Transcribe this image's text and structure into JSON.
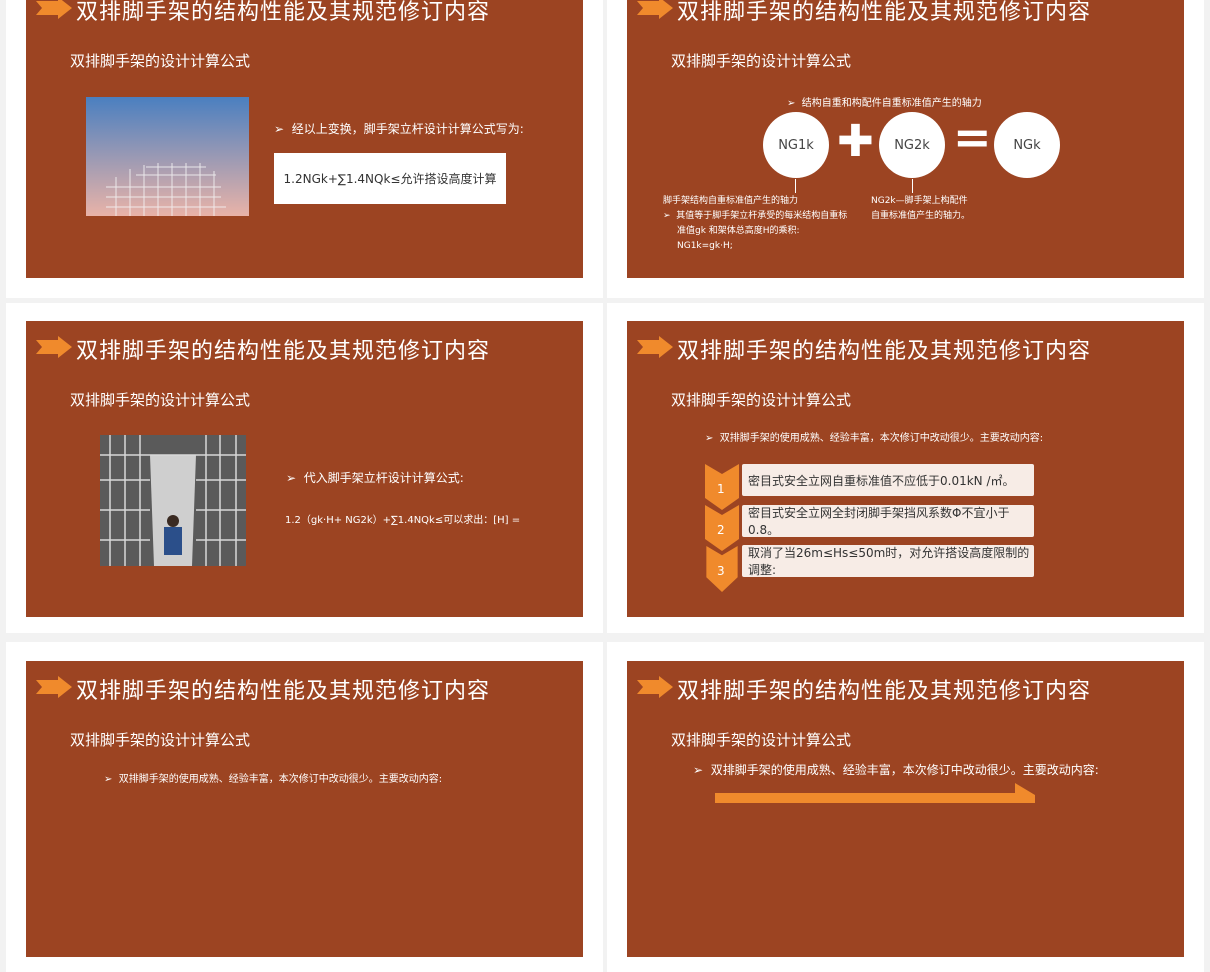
{
  "slide_title": "双排脚手架的结构性能及其规范修订内容",
  "slide_subtitle": "双排脚手架的设计计算公式",
  "s1": {
    "bullet": "经以上变换，脚手架立杆设计计算公式写为:",
    "formula": "1.2NGk+∑1.4NQk≤允许搭设高度计算"
  },
  "s2": {
    "top_note": "结构自重和构配件自重标准值产生的轴力",
    "c1": "NG1k",
    "c2": "NG2k",
    "c3": "NGk",
    "left_note_title": "脚手架结构自重标准值产生的轴力",
    "left_note_l1": "其值等于脚手架立杆承受的每米结构自重标",
    "left_note_l2": "准值gk 和架体总高度H的乘积:",
    "left_note_l3": "NG1k=gk·H;",
    "right_note_l1": "NG2k—脚手架上构配件",
    "right_note_l2": "自重标准值产生的轴力。"
  },
  "s3": {
    "bullet": "代入脚手架立杆设计计算公式:",
    "formula": "1.2（gk·H+ NG2k）+∑1.4NQk≤可以求出：[H] ="
  },
  "s4": {
    "bullet": "双排脚手架的使用成熟、经验丰富，本次修订中改动很少。主要改动内容:",
    "items": [
      {
        "n": "1",
        "text": "密目式安全立网自重标准值不应低于0.01kN /㎡。"
      },
      {
        "n": "2",
        "text": "密目式安全立网全封闭脚手架挡风系数Φ不宜小于0.8。"
      },
      {
        "n": "3",
        "text": "取消了当26m≤Hs≤50m时，对允许搭设高度限制的调整:"
      }
    ]
  },
  "s5": {
    "bullet": "双排脚手架的使用成熟、经验丰富，本次修订中改动很少。主要改动内容:"
  },
  "s6": {
    "bullet": "双排脚手架的使用成熟、经验丰富，本次修订中改动很少。主要改动内容:"
  },
  "colors": {
    "slide_bg": "#9c4422",
    "accent": "#f08a2c",
    "frame": "#ffffff",
    "page_bg": "#f2f2f2"
  }
}
